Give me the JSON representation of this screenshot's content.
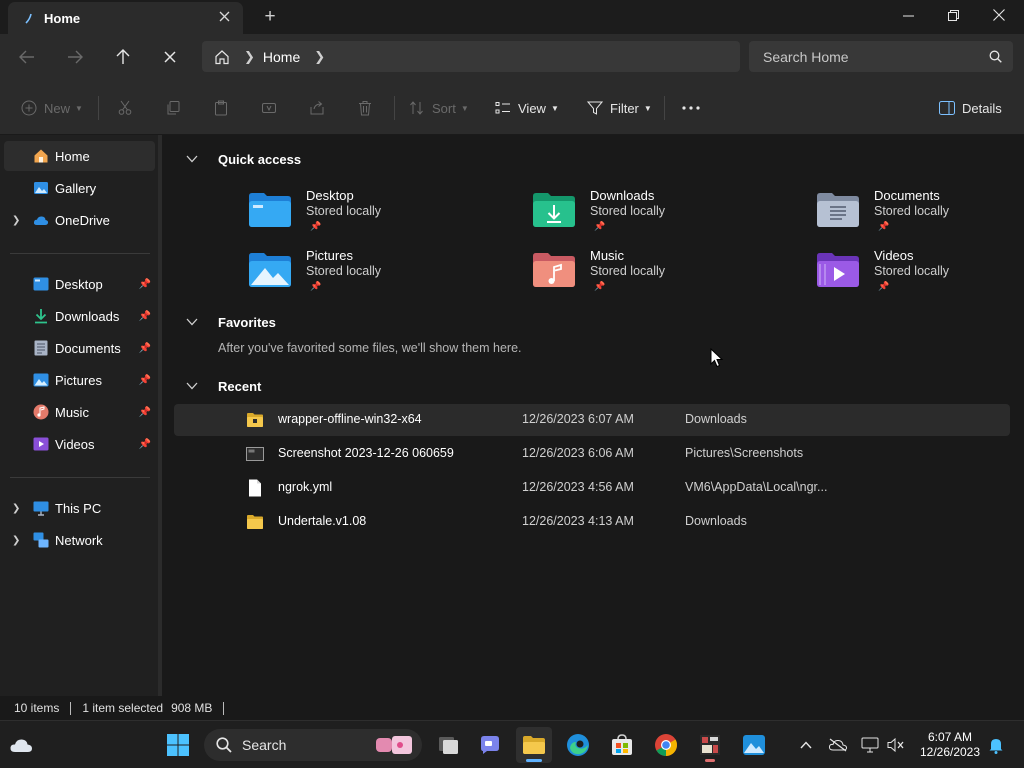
{
  "window": {
    "tab_title": "Home",
    "new_tab_symbol": "+"
  },
  "address_bar": {
    "crumbs": [
      "Home"
    ],
    "search_placeholder": "Search Home"
  },
  "command_bar": {
    "new_label": "New",
    "sort_label": "Sort",
    "view_label": "View",
    "filter_label": "Filter",
    "details_label": "Details"
  },
  "nav_pane": {
    "top_items": [
      {
        "label": "Home",
        "icon": "home-icon",
        "selected": true
      },
      {
        "label": "Gallery",
        "icon": "gallery-icon"
      },
      {
        "label": "OneDrive",
        "icon": "onedrive-cloud-icon",
        "expandable": true
      }
    ],
    "pinned_items": [
      {
        "label": "Desktop",
        "icon": "desktop-icon"
      },
      {
        "label": "Downloads",
        "icon": "downloads-icon"
      },
      {
        "label": "Documents",
        "icon": "documents-icon"
      },
      {
        "label": "Pictures",
        "icon": "pictures-icon"
      },
      {
        "label": "Music",
        "icon": "music-icon"
      },
      {
        "label": "Videos",
        "icon": "videos-icon"
      }
    ],
    "bottom_items": [
      {
        "label": "This PC",
        "icon": "pc-icon",
        "expandable": true
      },
      {
        "label": "Network",
        "icon": "network-icon",
        "expandable": true
      }
    ]
  },
  "content": {
    "quick_access": {
      "title": "Quick access",
      "items": [
        {
          "name": "Desktop",
          "sub": "Stored locally",
          "icon": "desktop-folder-icon"
        },
        {
          "name": "Downloads",
          "sub": "Stored locally",
          "icon": "downloads-folder-icon"
        },
        {
          "name": "Documents",
          "sub": "Stored locally",
          "icon": "documents-folder-icon"
        },
        {
          "name": "Pictures",
          "sub": "Stored locally",
          "icon": "pictures-folder-icon"
        },
        {
          "name": "Music",
          "sub": "Stored locally",
          "icon": "music-folder-icon"
        },
        {
          "name": "Videos",
          "sub": "Stored locally",
          "icon": "videos-folder-icon"
        }
      ]
    },
    "favorites": {
      "title": "Favorites",
      "empty_text": "After you've favorited some files, we'll show them here."
    },
    "recent": {
      "title": "Recent",
      "rows": [
        {
          "name": "wrapper-offline-win32-x64",
          "date": "12/26/2023 6:07 AM",
          "location": "Downloads",
          "icon": "zip-folder-icon"
        },
        {
          "name": "Screenshot 2023-12-26 060659",
          "date": "12/26/2023 6:06 AM",
          "location": "Pictures\\Screenshots",
          "icon": "image-file-icon"
        },
        {
          "name": "ngrok.yml",
          "date": "12/26/2023 4:56 AM",
          "location": "VM6\\AppData\\Local\\ngr...",
          "icon": "text-file-icon"
        },
        {
          "name": "Undertale.v1.08",
          "date": "12/26/2023 4:13 AM",
          "location": "Downloads",
          "icon": "folder-icon"
        }
      ]
    }
  },
  "status_bar": {
    "item_count": "10 items",
    "selection": "1 item selected",
    "size": "908 MB"
  },
  "taskbar": {
    "search_label": "Search",
    "time": "6:07 AM",
    "date": "12/26/2023"
  },
  "colors": {
    "accent": "#5fb2ff",
    "window_bg": "#191919",
    "toolbar_bg": "#2b2b2b"
  }
}
